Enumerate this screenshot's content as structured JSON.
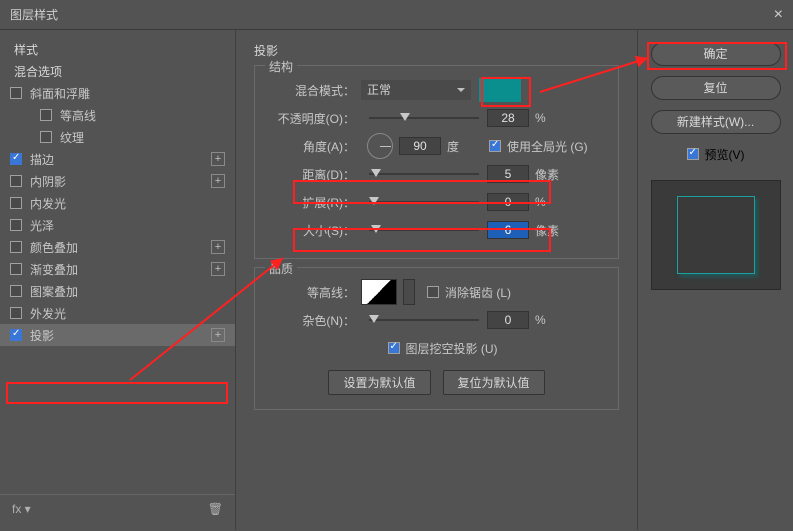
{
  "window": {
    "title": "图层样式",
    "close": "×"
  },
  "left": {
    "header_style": "样式",
    "header_blend": "混合选项",
    "items": [
      {
        "label": "斜面和浮雕",
        "checked": false,
        "plus": false
      },
      {
        "label": "等高线",
        "checked": false,
        "sub": true,
        "plus": false
      },
      {
        "label": "纹理",
        "checked": false,
        "sub": true,
        "plus": false
      },
      {
        "label": "描边",
        "checked": true,
        "plus": true
      },
      {
        "label": "内阴影",
        "checked": false,
        "plus": true
      },
      {
        "label": "内发光",
        "checked": false,
        "plus": false
      },
      {
        "label": "光泽",
        "checked": false,
        "plus": false
      },
      {
        "label": "颜色叠加",
        "checked": false,
        "plus": true
      },
      {
        "label": "渐变叠加",
        "checked": false,
        "plus": true
      },
      {
        "label": "图案叠加",
        "checked": false,
        "plus": false
      },
      {
        "label": "外发光",
        "checked": false,
        "plus": false
      },
      {
        "label": "投影",
        "checked": true,
        "plus": true,
        "selected": true
      }
    ],
    "fx_label": "fx"
  },
  "middle": {
    "title": "投影",
    "structure": {
      "legend": "结构",
      "blend_mode_label": "混合模式：",
      "blend_mode_value": "正常",
      "opacity_label": "不透明度(O)：",
      "opacity_value": "28",
      "opacity_unit": "%",
      "angle_label": "角度(A)：",
      "angle_value": "90",
      "angle_unit": "度",
      "use_global_label": "使用全局光 (G)",
      "distance_label": "距离(D)：",
      "distance_value": "5",
      "distance_unit": "像素",
      "spread_label": "扩展(R)：",
      "spread_value": "0",
      "spread_unit": "%",
      "size_label": "大小(S)：",
      "size_value": "6",
      "size_unit": "像素"
    },
    "quality": {
      "legend": "品质",
      "contour_label": "等高线：",
      "antialias_label": "消除锯齿 (L)",
      "noise_label": "杂色(N)：",
      "noise_value": "0",
      "noise_unit": "%",
      "knockout_label": "图层挖空投影 (U)"
    },
    "buttons": {
      "default_set": "设置为默认值",
      "default_reset": "复位为默认值"
    }
  },
  "right": {
    "ok": "确定",
    "reset": "复位",
    "new_style": "新建样式(W)...",
    "preview_label": "预览(V)"
  },
  "colors": {
    "swatch": "#0b8e8e"
  }
}
